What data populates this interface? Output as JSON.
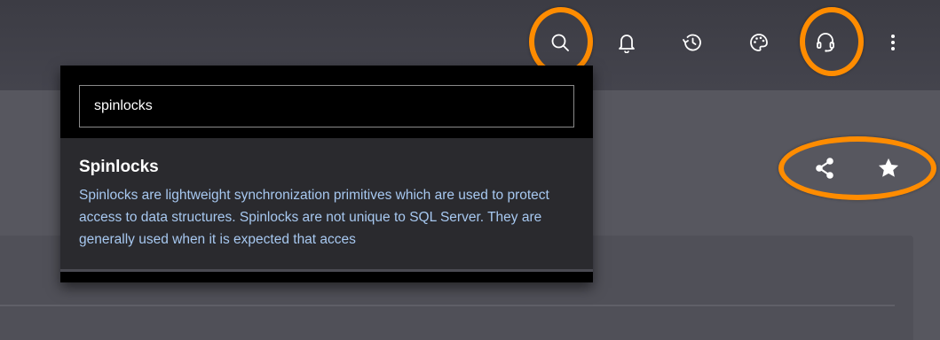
{
  "header": {
    "icons": [
      {
        "name": "search-icon",
        "highlighted": true
      },
      {
        "name": "bell-icon",
        "highlighted": false
      },
      {
        "name": "history-icon",
        "highlighted": false
      },
      {
        "name": "palette-icon",
        "highlighted": false
      },
      {
        "name": "headset-icon",
        "highlighted": true
      },
      {
        "name": "more-vertical-icon",
        "highlighted": false
      }
    ]
  },
  "page_actions": {
    "icons": [
      "share-icon",
      "star-icon"
    ],
    "highlighted": true
  },
  "search": {
    "query": "spinlocks",
    "results": [
      {
        "title": "Spinlocks",
        "snippet": "Spinlocks are lightweight synchronization primitives which are used to protect access to data structures. Spinlocks are not unique to SQL Server. They are generally used when it is expected that acces"
      }
    ]
  },
  "colors": {
    "highlight": "#ff8c00",
    "link_text": "#a7c8f0",
    "topbar": "#3f3f47",
    "background": "#57575f"
  }
}
